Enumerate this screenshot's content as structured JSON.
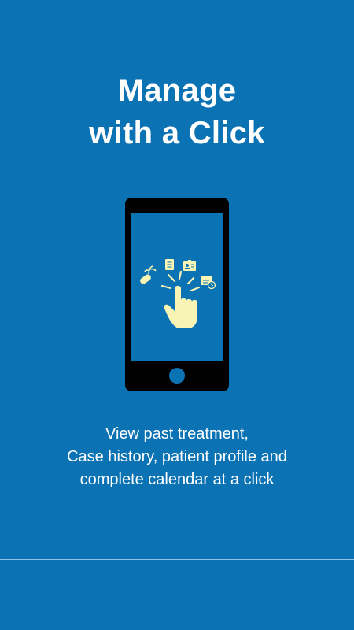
{
  "colors": {
    "background": "#0b72b3",
    "device": "#000000",
    "device_screen": "#0b72b3",
    "accent": "#f7f4b6",
    "divider": "#8fc1e3"
  },
  "onboarding": {
    "title_line1": "Manage",
    "title_line2": "with a Click",
    "description_line1": "View past treatment,",
    "description_line2": "Case history, patient profile and",
    "description_line3": "complete calendar at a click"
  },
  "icons": {
    "phone": "smartphone-icon",
    "hand": "tapping-hand-icon",
    "treatment": "pill-leaf-icon",
    "history": "document-icon",
    "profile": "id-card-icon",
    "calendar": "calendar-clock-icon"
  }
}
